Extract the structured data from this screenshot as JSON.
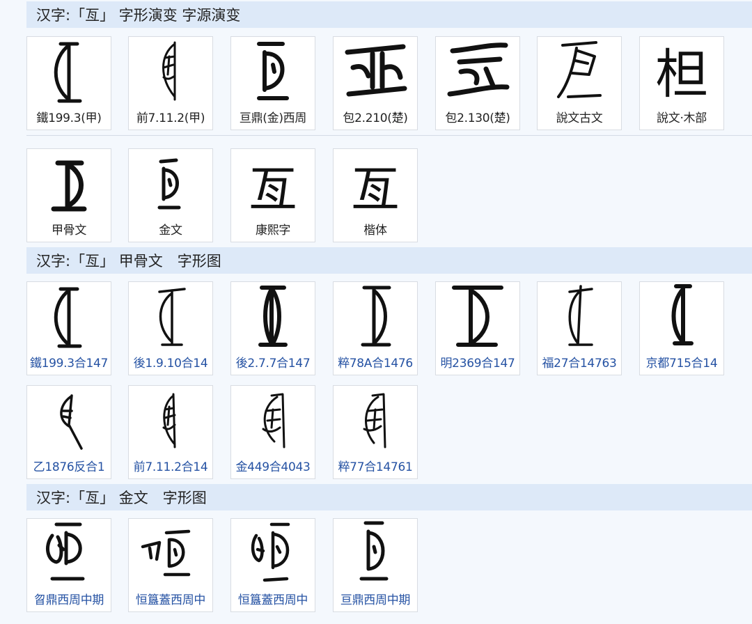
{
  "sections": {
    "evolution": {
      "title": "汉字:「亙」 字形演变 字源演变"
    },
    "oracle": {
      "title": "汉字:「亙」 甲骨文　字形图"
    },
    "bronze": {
      "title": "汉字:「亙」 金文　字形图"
    }
  },
  "evolution_row1": [
    {
      "label": "鐵199.3(甲)"
    },
    {
      "label": "前7.11.2(甲)"
    },
    {
      "label": "亘鼎(金)西周"
    },
    {
      "label": "包2.210(楚)"
    },
    {
      "label": "包2.130(楚)"
    },
    {
      "label": "說文古文"
    },
    {
      "label": "說文‧木部"
    }
  ],
  "evolution_row2": [
    {
      "label": "甲骨文"
    },
    {
      "label": "金文"
    },
    {
      "label": "康熙字"
    },
    {
      "label": "楷体"
    }
  ],
  "oracle_row1": [
    {
      "label": "鐵199.3合147"
    },
    {
      "label": "後1.9.10合14"
    },
    {
      "label": "後2.7.7合147"
    },
    {
      "label": "粹78A合1476"
    },
    {
      "label": "明2369合147"
    },
    {
      "label": "福27合14763"
    },
    {
      "label": "京都715合14"
    }
  ],
  "oracle_row2": [
    {
      "label": "乙1876反合1"
    },
    {
      "label": "前7.11.2合14"
    },
    {
      "label": "金449合4043"
    },
    {
      "label": "粹77合14761"
    }
  ],
  "bronze_row1": [
    {
      "label": "曶鼎西周中期"
    },
    {
      "label": "恒簋蓋西周中"
    },
    {
      "label": "恒簋蓋西周中"
    },
    {
      "label": "亘鼎西周中期"
    }
  ],
  "glyphs": {
    "kangxi": "亙",
    "kaishu": "亙",
    "shuowen_mubu": "柦"
  }
}
